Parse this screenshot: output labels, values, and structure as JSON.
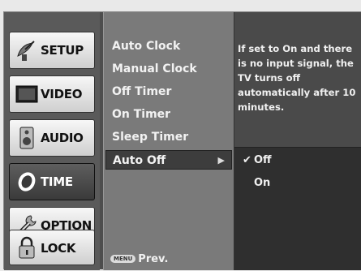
{
  "sidebar": {
    "items": [
      {
        "label": "SETUP",
        "icon": "satellite-dish-icon",
        "active": false
      },
      {
        "label": "VIDEO",
        "icon": "monitor-icon",
        "active": false
      },
      {
        "label": "AUDIO",
        "icon": "speaker-icon",
        "active": false
      },
      {
        "label": "TIME",
        "icon": "clock-icon",
        "active": true
      },
      {
        "label": "OPTION",
        "icon": "wrench-icon",
        "active": false
      },
      {
        "label": "LOCK",
        "icon": "padlock-icon",
        "active": false
      }
    ]
  },
  "menu": {
    "items": [
      {
        "label": "Auto Clock"
      },
      {
        "label": "Manual Clock"
      },
      {
        "label": "Off Timer"
      },
      {
        "label": "On Timer"
      },
      {
        "label": "Sleep Timer"
      },
      {
        "label": "Auto Off",
        "selected": true,
        "arrow": "▶"
      }
    ],
    "footer": {
      "key": "MENU",
      "label": "Prev."
    }
  },
  "info": {
    "description": "If set to On and there is no input signal, the TV turns off automatically after 10 minutes."
  },
  "options": {
    "items": [
      {
        "label": "Off",
        "checked": true,
        "check": "✔"
      },
      {
        "label": "On",
        "checked": false,
        "check": ""
      }
    ]
  },
  "colors": {
    "panel_bg": "#4d4d4d",
    "menu_bg": "#7a7a7a",
    "selected_bg": "#3d3d3d",
    "info_bg": "#4a4a4a",
    "active_tab": "#3a3a3a",
    "inactive_tab": "#e0e0e0"
  }
}
